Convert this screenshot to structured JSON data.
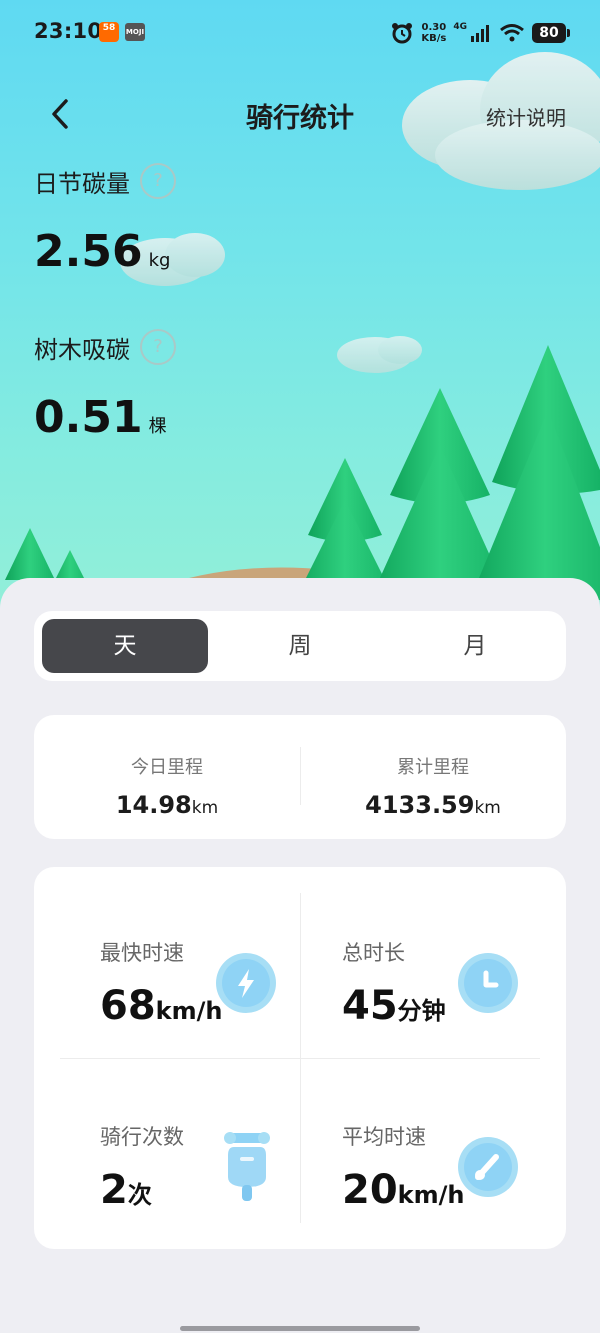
{
  "status_bar": {
    "time": "23:10",
    "app_badges": [
      "58",
      "MOJI"
    ],
    "net_speed_value": "0.30",
    "net_speed_unit": "KB/s",
    "network": "4G",
    "battery": "80"
  },
  "header": {
    "title": "骑行统计",
    "help_label": "统计说明"
  },
  "hero": {
    "carbon_saved": {
      "label": "日节碳量",
      "value": "2.56",
      "unit": "kg"
    },
    "tree_absorb": {
      "label": "树木吸碳",
      "value": "0.51",
      "unit": "棵"
    },
    "help_glyph": "?"
  },
  "tabs": {
    "items": [
      {
        "label": "天"
      },
      {
        "label": "周"
      },
      {
        "label": "月"
      }
    ],
    "selected": 0
  },
  "mileage": {
    "today": {
      "label": "今日里程",
      "value": "14.98",
      "unit": "km"
    },
    "total": {
      "label": "累计里程",
      "value": "4133.59",
      "unit": "km"
    }
  },
  "stats": {
    "fastest_speed": {
      "label": "最快时速",
      "value": "68",
      "unit": "km/h",
      "icon": "lightning-icon"
    },
    "total_duration": {
      "label": "总时长",
      "value": "45",
      "unit": "分钟",
      "icon": "clock-icon"
    },
    "ride_count": {
      "label": "骑行次数",
      "value": "2",
      "unit": "次",
      "icon": "scooter-icon"
    },
    "avg_speed": {
      "label": "平均时速",
      "value": "20",
      "unit": "km/h",
      "icon": "speedometer-icon"
    }
  },
  "colors": {
    "sky_top": "#5fd9f2",
    "sky_bottom": "#93efd8",
    "tree_green": "#1fbf6f",
    "tab_active": "#46474b",
    "icon_blue": "#8fd3f5"
  }
}
